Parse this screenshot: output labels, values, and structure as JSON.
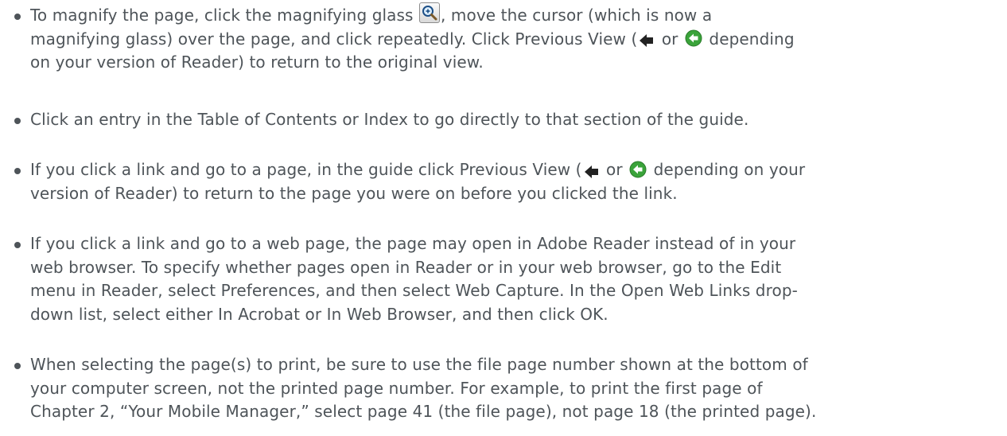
{
  "bullets": [
    {
      "parts": [
        "To magnify the page, click the magnifying glass ",
        ", move the cursor (which is now a\nmagnifying glass) over the page, and click repeatedly. Click Previous View (",
        " or ",
        " depending\non your version of Reader) to return to the original view."
      ]
    },
    {
      "parts": [
        "Click an entry in the Table of Contents or Index to go directly to that section of the guide."
      ]
    },
    {
      "parts": [
        "If you click a link and go to a page, in the guide click Previous View (",
        " or ",
        " depending on your\nversion of Reader) to return to the page you were on before you clicked the link."
      ]
    },
    {
      "parts": [
        "If you click a link and go to a web page, the page may open in Adobe Reader instead of in your\nweb browser. To specify whether pages open in Reader or in your web browser, go to the Edit\nmenu in Reader, select Preferences, and then select Web Capture. In the Open Web Links drop-\ndown list, select either In Acrobat or In Web Browser, and then click OK."
      ]
    },
    {
      "parts": [
        "When selecting the page(s) to print, be sure to use the file page number shown at the bottom of\nyour computer screen, not the printed page number. For example, to print the first page of\nChapter 2, “Your Mobile Manager,” select page 41 (the file page), not page 18 (the printed page)."
      ]
    }
  ],
  "icons": {
    "magnifier": "magnifying-glass-icon",
    "previous_view_arrow": "back-arrow-icon",
    "previous_view_circle": "green-back-circle-icon"
  },
  "colors": {
    "text": "#4e5459",
    "arrow": "#222222",
    "green_button": "#3aa33a"
  }
}
